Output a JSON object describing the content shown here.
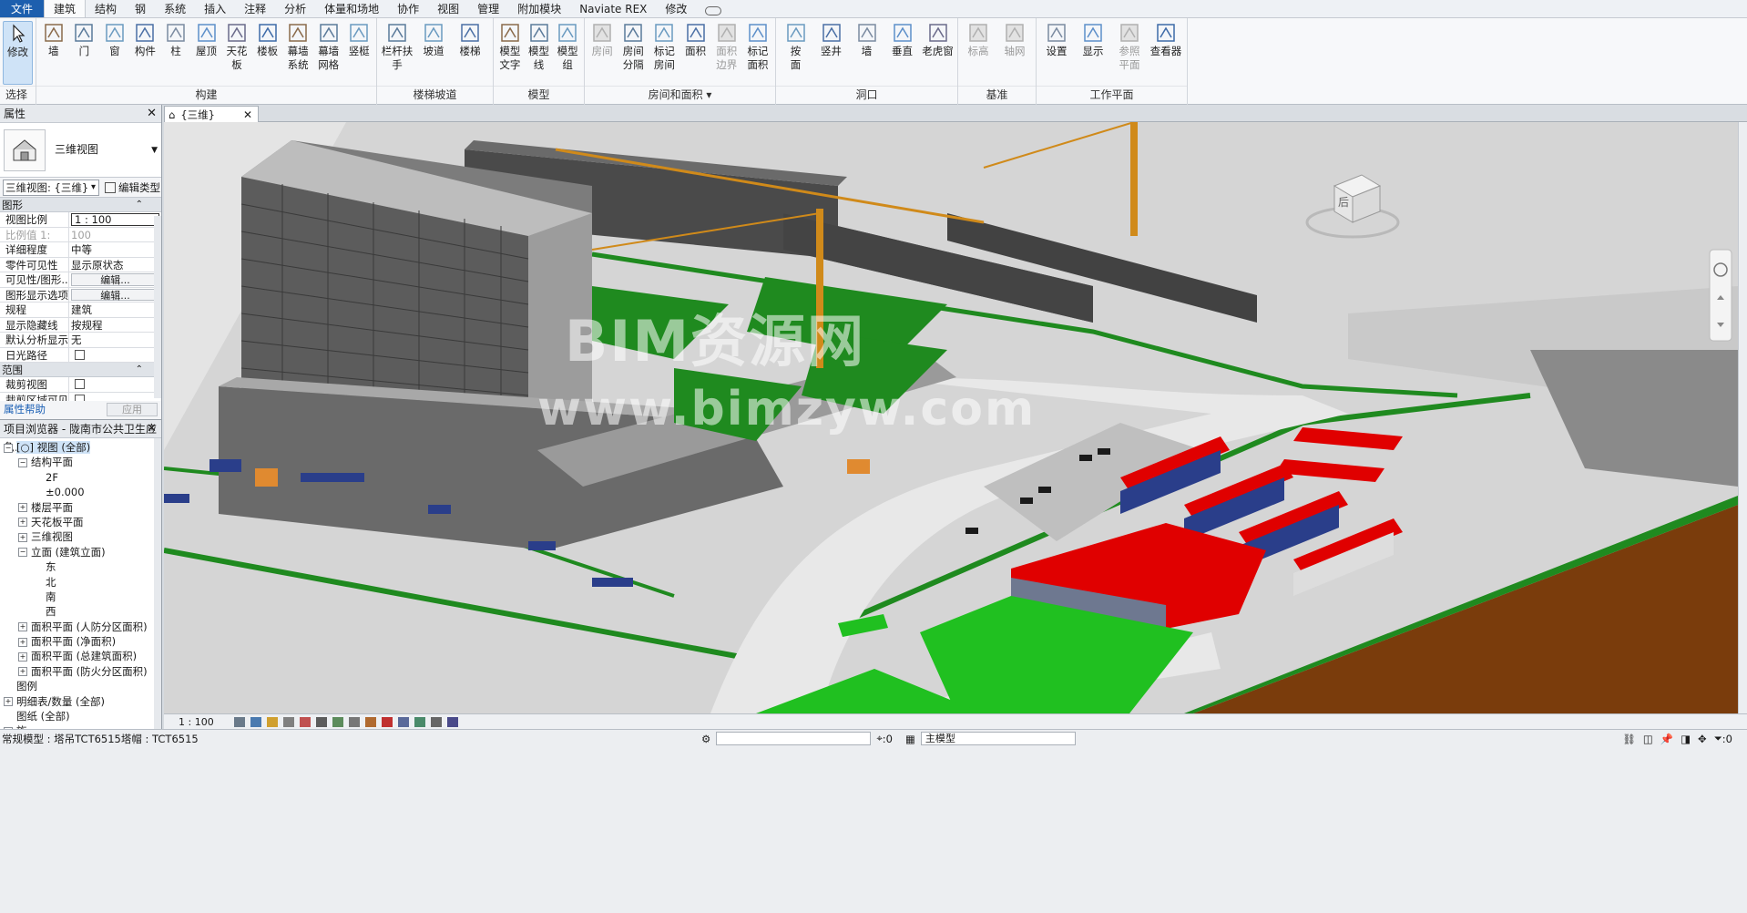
{
  "tabs": [
    "文件",
    "建筑",
    "结构",
    "钢",
    "系统",
    "插入",
    "注释",
    "分析",
    "体量和场地",
    "协作",
    "视图",
    "管理",
    "附加模块",
    "Naviate REX",
    "修改"
  ],
  "active_tab": "建筑",
  "ribbon": {
    "select": {
      "modify": "修改",
      "panel": "选择"
    },
    "build": {
      "tools": [
        "墙",
        "门",
        "窗",
        "构件",
        "柱",
        "屋顶",
        "天花板",
        "楼板",
        "幕墙\n系统",
        "幕墙\n网格",
        "竖梃"
      ],
      "panel": "构建"
    },
    "stairs": {
      "tools": [
        "栏杆扶手",
        "坡道",
        "楼梯"
      ],
      "panel": "楼梯坡道"
    },
    "model": {
      "tools": [
        "模型\n文字",
        "模型\n线",
        "模型\n组"
      ],
      "panel": "模型"
    },
    "rooms": {
      "tools": [
        "房间",
        "房间\n分隔",
        "标记\n房间",
        "面积",
        "面积\n边界",
        "标记\n面积"
      ],
      "panel": "房间和面积"
    },
    "opening": {
      "tools": [
        "按\n面",
        "竖井",
        "墙",
        "垂直",
        "老虎窗"
      ],
      "panel": "洞口"
    },
    "datum": {
      "tools": [
        "标高",
        "轴网"
      ],
      "panel": "基准"
    },
    "workplane": {
      "tools": [
        "设置",
        "显示",
        "参照\n平面",
        "查看器"
      ],
      "panel": "工作平面"
    }
  },
  "properties": {
    "title": "属性",
    "type_name": "三维视图",
    "view_selector": "三维视图: {三维}",
    "edit_type": "编辑类型",
    "sections": {
      "graphics": "图形",
      "extents": "范围"
    },
    "rows": [
      {
        "k": "视图比例",
        "v": "1 : 100",
        "kind": "input"
      },
      {
        "k": "比例值 1:",
        "v": "100",
        "kind": "disabled"
      },
      {
        "k": "详细程度",
        "v": "中等",
        "kind": "text"
      },
      {
        "k": "零件可见性",
        "v": "显示原状态",
        "kind": "text"
      },
      {
        "k": "可见性/图形...",
        "v": "编辑...",
        "kind": "button"
      },
      {
        "k": "图形显示选项",
        "v": "编辑...",
        "kind": "button"
      },
      {
        "k": "规程",
        "v": "建筑",
        "kind": "text"
      },
      {
        "k": "显示隐藏线",
        "v": "按规程",
        "kind": "text"
      },
      {
        "k": "默认分析显示...",
        "v": "无",
        "kind": "text"
      },
      {
        "k": "日光路径",
        "v": "",
        "kind": "check"
      }
    ],
    "extent_rows": [
      {
        "k": "裁剪视图",
        "v": "",
        "kind": "check"
      },
      {
        "k": "裁剪区域可见",
        "v": "",
        "kind": "check"
      }
    ],
    "help": "属性帮助",
    "apply": "应用"
  },
  "browser": {
    "title": "项目浏览器 - 陇南市公共卫生应急...",
    "nodes": [
      {
        "t": "[○] 视图 (全部)",
        "lvl": 0,
        "tog": "-",
        "sel": true
      },
      {
        "t": "结构平面",
        "lvl": 1,
        "tog": "-"
      },
      {
        "t": "2F",
        "lvl": 2,
        "tog": ""
      },
      {
        "t": "±0.000",
        "lvl": 2,
        "tog": ""
      },
      {
        "t": "楼层平面",
        "lvl": 1,
        "tog": "+"
      },
      {
        "t": "天花板平面",
        "lvl": 1,
        "tog": "+"
      },
      {
        "t": "三维视图",
        "lvl": 1,
        "tog": "+"
      },
      {
        "t": "立面 (建筑立面)",
        "lvl": 1,
        "tog": "-"
      },
      {
        "t": "东",
        "lvl": 2,
        "tog": ""
      },
      {
        "t": "北",
        "lvl": 2,
        "tog": ""
      },
      {
        "t": "南",
        "lvl": 2,
        "tog": ""
      },
      {
        "t": "西",
        "lvl": 2,
        "tog": ""
      },
      {
        "t": "面积平面 (人防分区面积)",
        "lvl": 1,
        "tog": "+"
      },
      {
        "t": "面积平面 (净面积)",
        "lvl": 1,
        "tog": "+"
      },
      {
        "t": "面积平面 (总建筑面积)",
        "lvl": 1,
        "tog": "+"
      },
      {
        "t": "面积平面 (防火分区面积)",
        "lvl": 1,
        "tog": "+"
      },
      {
        "t": "图例",
        "lvl": 0,
        "tog": ""
      },
      {
        "t": "明细表/数量 (全部)",
        "lvl": 0,
        "tog": "+"
      },
      {
        "t": "图纸 (全部)",
        "lvl": 0,
        "tog": ""
      },
      {
        "t": "族",
        "lvl": 0,
        "tog": "+"
      }
    ]
  },
  "view_tab": "{三维}",
  "watermark": {
    "line1": "BIM资源网",
    "line2": "www.bimzyw.com"
  },
  "viewcube_face": "后",
  "view_scale": "1 : 100",
  "status": {
    "message": "常规模型 : 塔吊TCT6515塔帽 : TCT6515",
    "filter_count": ":0",
    "model": "主模型",
    "sel_count": ":0"
  },
  "colors": {
    "accent": "#1d5fae",
    "grass": "#1f8a1f",
    "roof_red": "#e00000",
    "crane": "#d08a1a"
  }
}
